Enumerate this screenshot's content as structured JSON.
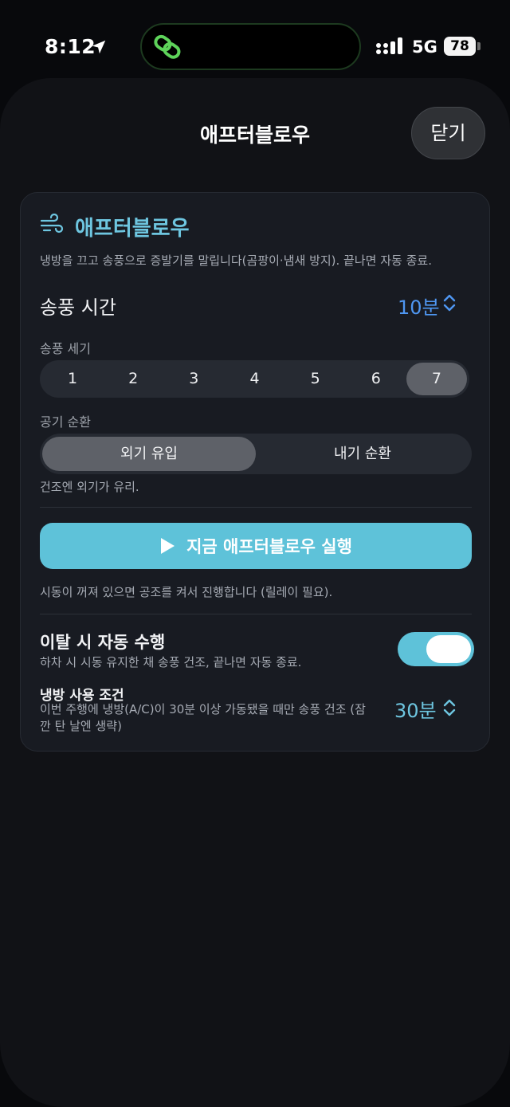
{
  "status_bar": {
    "time": "8:12",
    "network": "5G",
    "battery": "78",
    "location_icon": "location-arrow-icon",
    "signal_icon": "signal-bars-icon",
    "island_icon": "link-chain-icon"
  },
  "sheet": {
    "title": "애프터블로우",
    "close_label": "닫기"
  },
  "card": {
    "icon": "wind-icon",
    "title": "애프터블로우",
    "description": "냉방을 끄고 송풍으로 증발기를 말립니다(곰팡이·냄새 방지). 끝나면 자동 종료.",
    "fan_time": {
      "label": "송풍 시간",
      "value": "10분"
    },
    "fan_speed": {
      "label": "송풍 세기",
      "options": [
        "1",
        "2",
        "3",
        "4",
        "5",
        "6",
        "7"
      ],
      "selected": "7"
    },
    "air_circulation": {
      "label": "공기 순환",
      "options": [
        "외기 유입",
        "내기 순환"
      ],
      "selected": "외기 유입",
      "hint": "건조엔 외기가 유리."
    },
    "run_button": {
      "label": "지금 애프터블로우 실행",
      "icon": "play-icon"
    },
    "run_hint": "시동이 꺼져 있으면 공조를 켜서 진행합니다 (릴레이 필요).",
    "auto_run": {
      "title": "이탈 시 자동 수행",
      "description": "하차 시 시동 유지한 채 송풍 건조, 끝나면 자동 종료.",
      "enabled": true
    },
    "ac_condition": {
      "title": "냉방 사용 조건",
      "description": "이번 주행에 냉방(A/C)이 30분 이상 가동됐을 때만 송풍 건조 (잠깐 탄 날엔 생략)",
      "value": "30분"
    }
  },
  "colors": {
    "accent_cyan": "#5ec2d9",
    "accent_blue": "#4f97f2",
    "background": "#111216",
    "card": "#181b22"
  }
}
